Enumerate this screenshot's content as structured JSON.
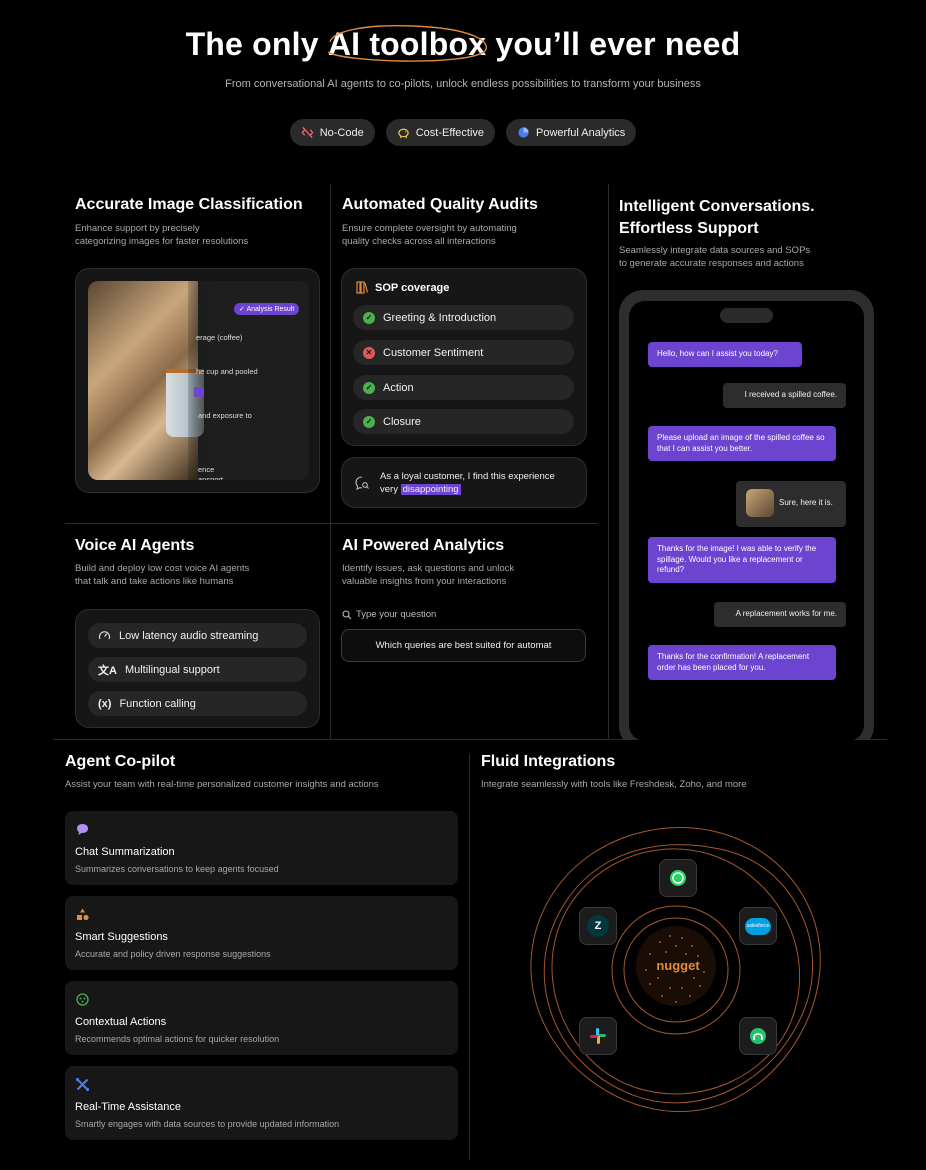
{
  "hero": {
    "title_pre": "The only ",
    "title_highlight": "AI toolbox",
    "title_post": " you’ll ever need",
    "subtitle": "From conversational AI agents to co-pilots, unlock endless possibilities to transform your business",
    "chips": [
      "No-Code",
      "Cost-Effective",
      "Powerful Analytics"
    ]
  },
  "image_classification": {
    "title": "Accurate Image Classification",
    "desc_line1": "Enhance support by precisely",
    "desc_line2": "categorizing images for faster resolutions",
    "badge": "Analysis Result",
    "lines": [
      "erage (coffee)",
      "he cup and pooled",
      "and exposure to",
      "ence",
      "ansport"
    ]
  },
  "quality_audits": {
    "title": "Automated Quality Audits",
    "desc_line1": "Ensure complete oversight by automating",
    "desc_line2": "quality checks across all interactions",
    "sop_title": "SOP coverage",
    "items": [
      {
        "label": "Greeting & Introduction",
        "status": "pass"
      },
      {
        "label": "Customer Sentiment",
        "status": "fail"
      },
      {
        "label": "Action",
        "status": "pass"
      },
      {
        "label": "Closure",
        "status": "pass"
      }
    ],
    "quote_pre": "As a loyal customer, I find this experience",
    "quote_mid": "very ",
    "quote_highlight": "disappointing"
  },
  "conversations": {
    "title_line1": "Intelligent Conversations.",
    "title_line2": "Effortless Support",
    "desc_line1": "Seamlessly integrate data sources and SOPs",
    "desc_line2": "to generate accurate responses and actions",
    "messages": [
      {
        "from": "bot",
        "text": "Hello, how can I assist you today?"
      },
      {
        "from": "user",
        "text": "I received a spilled coffee."
      },
      {
        "from": "bot",
        "text": "Please upload an image of the spilled coffee so that I can assist you better."
      },
      {
        "from": "user",
        "text": "Sure, here it is."
      },
      {
        "from": "bot",
        "text": "Thanks for the image! I was able to verify the spillage. Would you like a replacement or refund?"
      },
      {
        "from": "user",
        "text": "A replacement works for me."
      },
      {
        "from": "bot",
        "text": "Thanks for the confirmation! A replacement order has been placed for you."
      }
    ]
  },
  "voice": {
    "title": "Voice AI Agents",
    "desc_line1": "Build and deploy low cost voice AI agents",
    "desc_line2": "that talk and take actions like humans",
    "items": [
      "Low latency audio streaming",
      "Multilingual support",
      "Function calling"
    ]
  },
  "analytics": {
    "title": "AI Powered Analytics",
    "desc_line1": "Identify issues, ask questions and unlock",
    "desc_line2": "valuable insights from your interactions",
    "search_placeholder": "Type your question",
    "query": "Which queries are best suited for automat"
  },
  "copilot": {
    "title": "Agent Co-pilot",
    "desc": "Assist your team with real-time personalized customer insights and actions",
    "cards": [
      {
        "title": "Chat Summarization",
        "desc": "Summarizes conversations to keep agents focused"
      },
      {
        "title": "Smart Suggestions",
        "desc": "Accurate and policy driven response suggestions"
      },
      {
        "title": "Contextual Actions",
        "desc": "Recommends optimal actions for quicker resolution"
      },
      {
        "title": "Real-Time Assistance",
        "desc": "Smartly engages with data sources to provide updated information"
      }
    ]
  },
  "integrations": {
    "title": "Fluid Integrations",
    "desc": "Integrate seamlessly with tools like Freshdesk, Zoho, and more",
    "center": "nugget",
    "logos": [
      "whatsapp-icon",
      "zendesk-icon",
      "salesforce-icon",
      "slack-icon",
      "freshdesk-icon"
    ],
    "salesforce_text": "salesforce"
  },
  "colors": {
    "accent_purple": "#6c44d0",
    "accent_orange": "#e08a3c",
    "pass_green": "#4caf50",
    "fail_red": "#e05a5a"
  }
}
